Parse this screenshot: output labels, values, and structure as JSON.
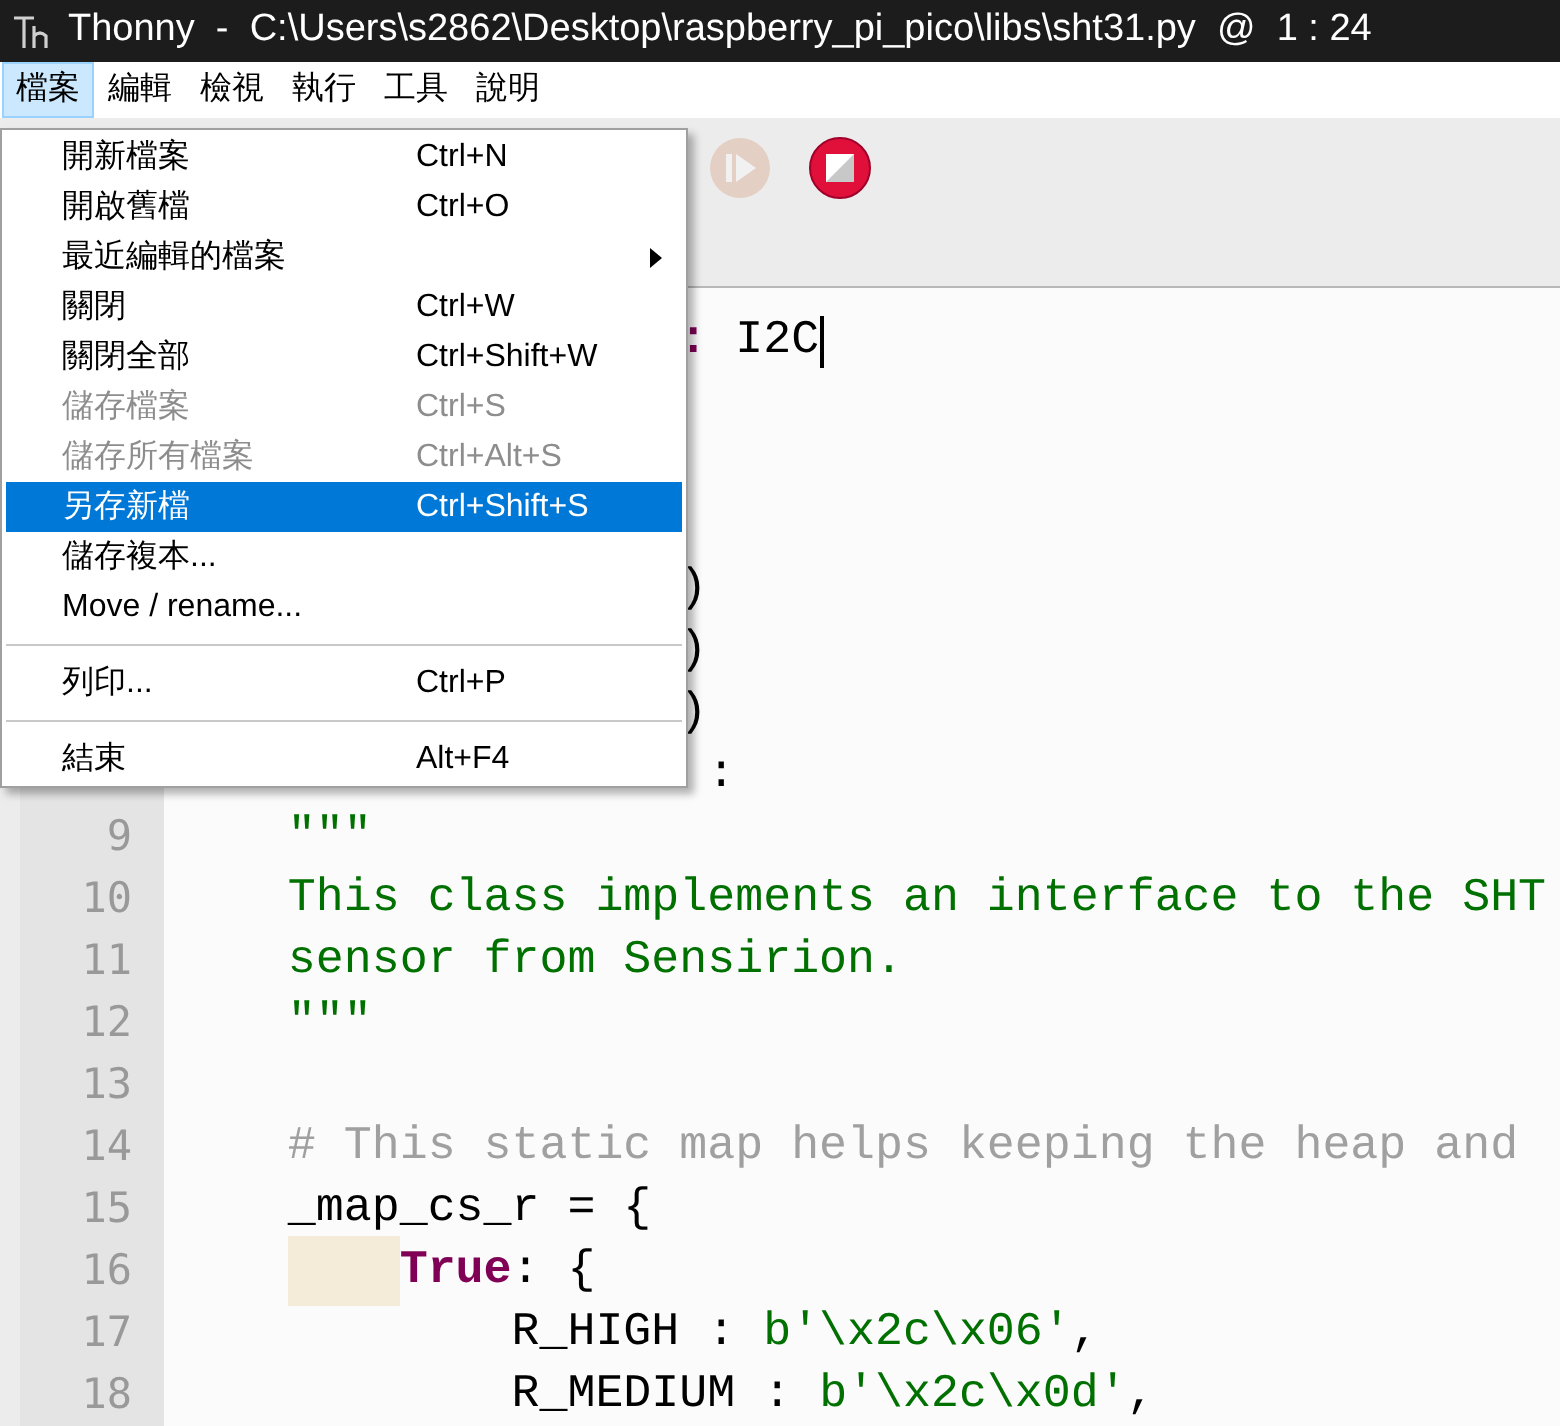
{
  "window": {
    "title": "Thonny  -  C:\\Users\\s2862\\Desktop\\raspberry_pi_pico\\libs\\sht31.py  @  1 : 24"
  },
  "menubar": [
    {
      "label": "檔案",
      "selected": true
    },
    {
      "label": "編輯",
      "selected": false
    },
    {
      "label": "檢視",
      "selected": false
    },
    {
      "label": "執行",
      "selected": false
    },
    {
      "label": "工具",
      "selected": false
    },
    {
      "label": "說明",
      "selected": false
    }
  ],
  "toolbar": {
    "buttons": [
      {
        "kind": "resume",
        "disabled": true
      },
      {
        "kind": "stop",
        "disabled": false
      }
    ]
  },
  "file_menu": {
    "items": [
      {
        "kind": "item",
        "label": "開新檔案",
        "shortcut": "Ctrl+N",
        "disabled": false,
        "selected": false,
        "submenu": false
      },
      {
        "kind": "item",
        "label": "開啟舊檔",
        "shortcut": "Ctrl+O",
        "disabled": false,
        "selected": false,
        "submenu": false
      },
      {
        "kind": "item",
        "label": "最近編輯的檔案",
        "disabled": false,
        "selected": false,
        "submenu": true
      },
      {
        "kind": "item",
        "label": "關閉",
        "shortcut": "Ctrl+W",
        "disabled": false,
        "selected": false,
        "submenu": false
      },
      {
        "kind": "item",
        "label": "關閉全部",
        "shortcut": "Ctrl+Shift+W",
        "disabled": false,
        "selected": false,
        "submenu": false
      },
      {
        "kind": "item",
        "label": "儲存檔案",
        "shortcut": "Ctrl+S",
        "disabled": true,
        "selected": false,
        "submenu": false
      },
      {
        "kind": "item",
        "label": "儲存所有檔案",
        "shortcut": "Ctrl+Alt+S",
        "disabled": true,
        "selected": false,
        "submenu": false
      },
      {
        "kind": "item",
        "label": "另存新檔",
        "shortcut": "Ctrl+Shift+S",
        "disabled": false,
        "selected": true,
        "submenu": false
      },
      {
        "kind": "item",
        "label": "儲存複本...",
        "disabled": false,
        "selected": false,
        "submenu": false
      },
      {
        "kind": "item",
        "label": "Move / rename...",
        "disabled": false,
        "selected": false,
        "submenu": false
      },
      {
        "kind": "separator"
      },
      {
        "kind": "item",
        "label": "列印...",
        "shortcut": "Ctrl+P",
        "disabled": false,
        "selected": false,
        "submenu": false
      },
      {
        "kind": "separator"
      },
      {
        "kind": "item",
        "label": "結束",
        "shortcut": "Alt+F4",
        "disabled": false,
        "selected": false,
        "submenu": false
      }
    ]
  },
  "editor": {
    "lines": [
      {
        "cursor": true,
        "tokens": [
          {
            "kind": "keyword",
            "text": "                  :"
          },
          {
            "kind": "plain",
            "text": " I2C"
          }
        ]
      },
      {
        "cursor": false
      },
      {
        "cursor": false
      },
      {
        "cursor": false
      },
      {
        "tokens": [
          {
            "kind": "plain",
            "text": "                  )"
          }
        ]
      },
      {
        "tokens": [
          {
            "kind": "plain",
            "text": "                  )"
          }
        ]
      },
      {
        "tokens": [
          {
            "kind": "plain",
            "text": "                  )"
          }
        ]
      },
      {
        "tokens": [
          {
            "kind": "plain",
            "text": "                   :"
          }
        ]
      },
      {
        "number": "9",
        "tokens": [
          {
            "kind": "string",
            "text": "    \"\"\""
          }
        ]
      },
      {
        "number": "10",
        "tokens": [
          {
            "kind": "string",
            "text": "    This class implements an interface to the SHT"
          }
        ]
      },
      {
        "number": "11",
        "tokens": [
          {
            "kind": "string",
            "text": "    sensor from Sensirion."
          }
        ]
      },
      {
        "number": "12",
        "tokens": [
          {
            "kind": "string",
            "text": "    \"\"\""
          }
        ]
      },
      {
        "number": "13"
      },
      {
        "number": "14",
        "tokens": [
          {
            "kind": "comment",
            "text": "    # This static map helps keeping the heap and"
          }
        ]
      },
      {
        "number": "15",
        "tokens": [
          {
            "kind": "plain",
            "text": "    _map_cs_r = {"
          }
        ]
      },
      {
        "number": "16",
        "indent_guide": true,
        "tokens": [
          {
            "kind": "keyword",
            "text": "        True"
          },
          {
            "kind": "plain",
            "text": ": {"
          }
        ]
      },
      {
        "number": "17",
        "tokens": [
          {
            "kind": "plain",
            "text": "            R_HIGH : "
          },
          {
            "kind": "string",
            "text": "b'\\x2c\\x06'"
          },
          {
            "kind": "plain",
            "text": ","
          }
        ]
      },
      {
        "number": "18",
        "tokens": [
          {
            "kind": "plain",
            "text": "            R_MEDIUM : "
          },
          {
            "kind": "string",
            "text": "b'\\x2c\\x0d'"
          },
          {
            "kind": "plain",
            "text": ","
          }
        ]
      }
    ]
  }
}
